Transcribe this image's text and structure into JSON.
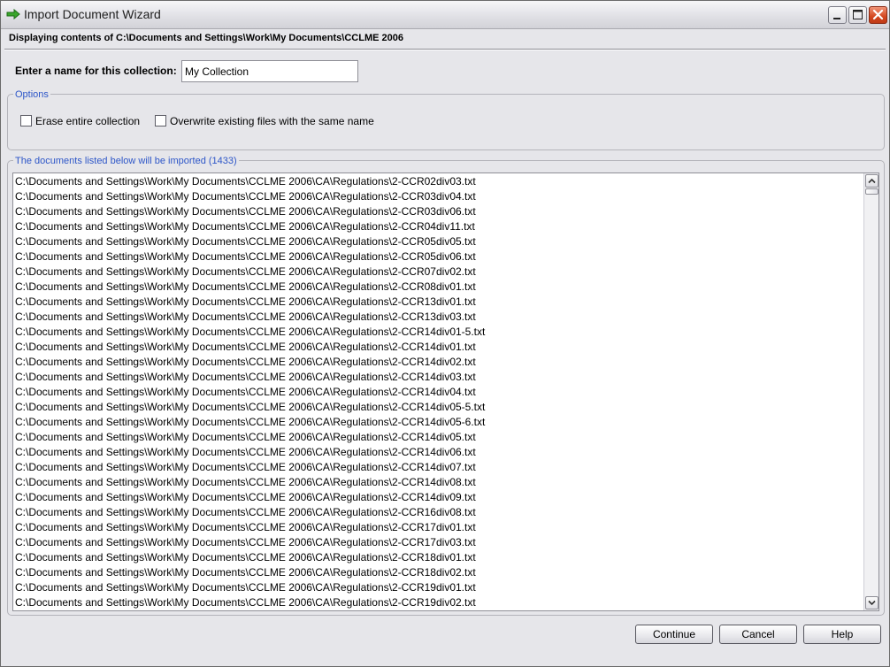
{
  "window": {
    "title": "Import Document Wizard"
  },
  "header": {
    "path_text": "Displaying contents of C:\\Documents and Settings\\Work\\My Documents\\CCLME 2006"
  },
  "name_field": {
    "label": "Enter a name for this collection:",
    "value": "My Collection"
  },
  "options": {
    "legend": "Options",
    "erase_label": "Erase entire collection",
    "erase_checked": false,
    "overwrite_label": "Overwrite existing files with the same name",
    "overwrite_checked": false
  },
  "documents": {
    "legend": "The documents listed below will be imported (1433)",
    "items": [
      "C:\\Documents and Settings\\Work\\My Documents\\CCLME 2006\\CA\\Regulations\\2-CCR02div03.txt",
      "C:\\Documents and Settings\\Work\\My Documents\\CCLME 2006\\CA\\Regulations\\2-CCR03div04.txt",
      "C:\\Documents and Settings\\Work\\My Documents\\CCLME 2006\\CA\\Regulations\\2-CCR03div06.txt",
      "C:\\Documents and Settings\\Work\\My Documents\\CCLME 2006\\CA\\Regulations\\2-CCR04div11.txt",
      "C:\\Documents and Settings\\Work\\My Documents\\CCLME 2006\\CA\\Regulations\\2-CCR05div05.txt",
      "C:\\Documents and Settings\\Work\\My Documents\\CCLME 2006\\CA\\Regulations\\2-CCR05div06.txt",
      "C:\\Documents and Settings\\Work\\My Documents\\CCLME 2006\\CA\\Regulations\\2-CCR07div02.txt",
      "C:\\Documents and Settings\\Work\\My Documents\\CCLME 2006\\CA\\Regulations\\2-CCR08div01.txt",
      "C:\\Documents and Settings\\Work\\My Documents\\CCLME 2006\\CA\\Regulations\\2-CCR13div01.txt",
      "C:\\Documents and Settings\\Work\\My Documents\\CCLME 2006\\CA\\Regulations\\2-CCR13div03.txt",
      "C:\\Documents and Settings\\Work\\My Documents\\CCLME 2006\\CA\\Regulations\\2-CCR14div01-5.txt",
      "C:\\Documents and Settings\\Work\\My Documents\\CCLME 2006\\CA\\Regulations\\2-CCR14div01.txt",
      "C:\\Documents and Settings\\Work\\My Documents\\CCLME 2006\\CA\\Regulations\\2-CCR14div02.txt",
      "C:\\Documents and Settings\\Work\\My Documents\\CCLME 2006\\CA\\Regulations\\2-CCR14div03.txt",
      "C:\\Documents and Settings\\Work\\My Documents\\CCLME 2006\\CA\\Regulations\\2-CCR14div04.txt",
      "C:\\Documents and Settings\\Work\\My Documents\\CCLME 2006\\CA\\Regulations\\2-CCR14div05-5.txt",
      "C:\\Documents and Settings\\Work\\My Documents\\CCLME 2006\\CA\\Regulations\\2-CCR14div05-6.txt",
      "C:\\Documents and Settings\\Work\\My Documents\\CCLME 2006\\CA\\Regulations\\2-CCR14div05.txt",
      "C:\\Documents and Settings\\Work\\My Documents\\CCLME 2006\\CA\\Regulations\\2-CCR14div06.txt",
      "C:\\Documents and Settings\\Work\\My Documents\\CCLME 2006\\CA\\Regulations\\2-CCR14div07.txt",
      "C:\\Documents and Settings\\Work\\My Documents\\CCLME 2006\\CA\\Regulations\\2-CCR14div08.txt",
      "C:\\Documents and Settings\\Work\\My Documents\\CCLME 2006\\CA\\Regulations\\2-CCR14div09.txt",
      "C:\\Documents and Settings\\Work\\My Documents\\CCLME 2006\\CA\\Regulations\\2-CCR16div08.txt",
      "C:\\Documents and Settings\\Work\\My Documents\\CCLME 2006\\CA\\Regulations\\2-CCR17div01.txt",
      "C:\\Documents and Settings\\Work\\My Documents\\CCLME 2006\\CA\\Regulations\\2-CCR17div03.txt",
      "C:\\Documents and Settings\\Work\\My Documents\\CCLME 2006\\CA\\Regulations\\2-CCR18div01.txt",
      "C:\\Documents and Settings\\Work\\My Documents\\CCLME 2006\\CA\\Regulations\\2-CCR18div02.txt",
      "C:\\Documents and Settings\\Work\\My Documents\\CCLME 2006\\CA\\Regulations\\2-CCR19div01.txt",
      "C:\\Documents and Settings\\Work\\My Documents\\CCLME 2006\\CA\\Regulations\\2-CCR19div02.txt"
    ]
  },
  "buttons": {
    "continue_label": "Continue",
    "cancel_label": "Cancel",
    "help_label": "Help"
  },
  "icons": {
    "title_icon": "green-arrow-icon",
    "minimize": "minimize-icon",
    "maximize": "maximize-icon",
    "close": "close-icon",
    "scroll_up": "chevron-up-icon",
    "scroll_down": "chevron-down-icon"
  },
  "colors": {
    "legend_text": "#2d56c8",
    "close_button": "#d4471f",
    "title_arrow": "#3aa62c"
  }
}
